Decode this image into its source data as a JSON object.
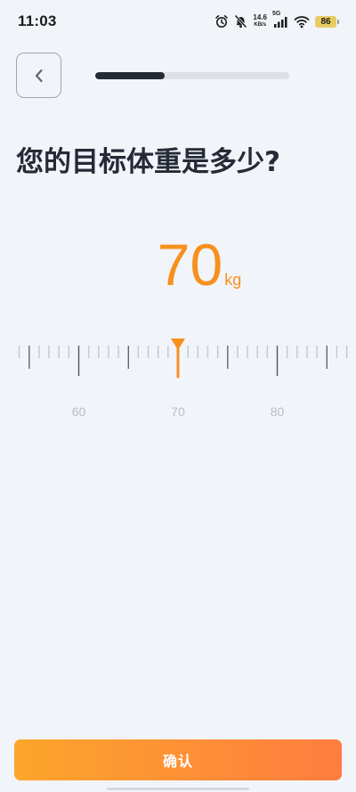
{
  "status_bar": {
    "time": "11:03",
    "net_speed_value": "14.6",
    "net_speed_unit": "KB/s",
    "network_type": "5G",
    "battery": "86",
    "icons": [
      "alarm-icon",
      "mute-icon",
      "signal-icon",
      "wifi-icon",
      "battery-icon"
    ]
  },
  "header": {
    "back_icon": "chevron-left-icon",
    "progress_fraction": 0.36
  },
  "question": {
    "title": "您的目标体重是多少?"
  },
  "weight": {
    "value": "70",
    "unit": "kg"
  },
  "ruler": {
    "min_visible": 54,
    "max_visible": 89,
    "selected": 70,
    "major_every": 5,
    "labels": [
      "60",
      "70",
      "80"
    ]
  },
  "footer": {
    "confirm_label": "确认"
  },
  "colors": {
    "accent": "#f7901e",
    "title": "#252a36",
    "background": "#f1f4f9",
    "button_gradient_start": "#fda52b",
    "button_gradient_end": "#fe7d3f"
  }
}
